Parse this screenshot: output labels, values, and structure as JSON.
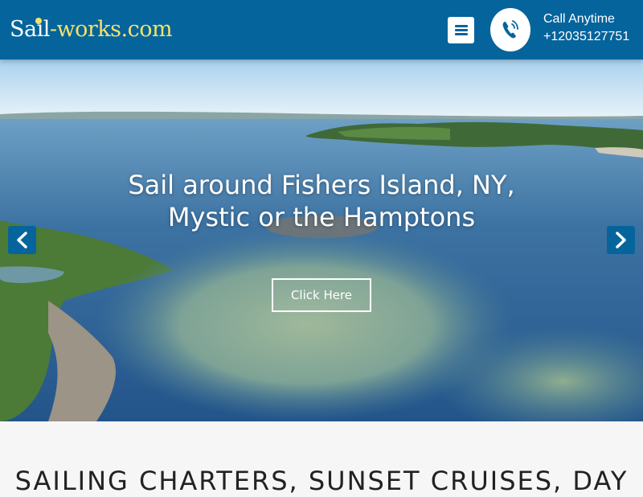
{
  "header": {
    "logo_part1": "Sail",
    "logo_part2": "-works.com",
    "call_label": "Call Anytime",
    "call_number": "+12035127751",
    "menu_icon": "hamburger-menu-icon",
    "phone_icon": "phone-ringing-icon",
    "colors": {
      "bar": "#05649c",
      "logo_accent": "#f3e26b"
    }
  },
  "hero": {
    "title": "Sail around Fishers Island, NY, Mystic or the Hamptons",
    "cta_label": "Click Here",
    "prev_icon": "chevron-left-icon",
    "next_icon": "chevron-right-icon"
  },
  "content": {
    "section_title": "SAILING CHARTERS, SUNSET CRUISES, DAY"
  }
}
